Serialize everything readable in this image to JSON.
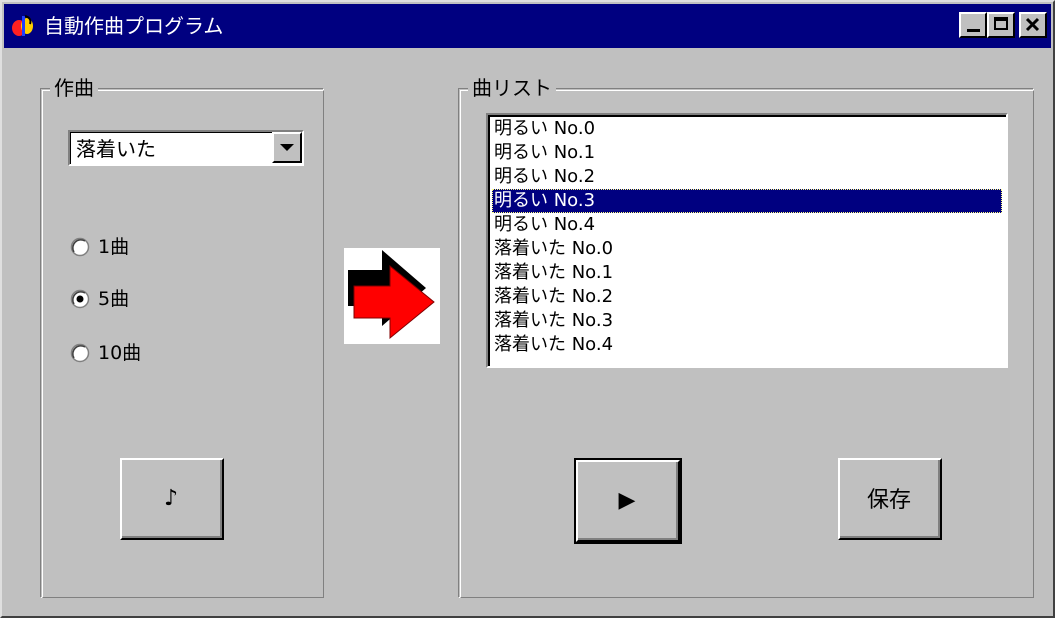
{
  "window": {
    "title": "自動作曲プログラム",
    "title_bar_color": "#000080",
    "icons": [
      "music-app-icon",
      "minimize-icon",
      "maximize-icon",
      "close-icon"
    ]
  },
  "compose_group": {
    "title": "作曲",
    "mood_select": {
      "value": "落着いた"
    },
    "radios": [
      {
        "label": "1曲",
        "checked": false
      },
      {
        "label": "5曲",
        "checked": true
      },
      {
        "label": "10曲",
        "checked": false
      }
    ],
    "compose_button_label": "♪"
  },
  "song_list_group": {
    "title": "曲リスト",
    "items": [
      "明るい No.0",
      "明るい No.1",
      "明るい No.2",
      "明るい No.3",
      "明るい No.4",
      "落着いた No.0",
      "落着いた No.1",
      "落着いた No.2",
      "落着いた No.3",
      "落着いた No.4"
    ],
    "selected_index": 3,
    "play_button_label": "▶",
    "save_button_label": "保存"
  },
  "colors": {
    "selection": "#000080",
    "arrow": "#ff0000",
    "face": "#c0c0c0"
  }
}
